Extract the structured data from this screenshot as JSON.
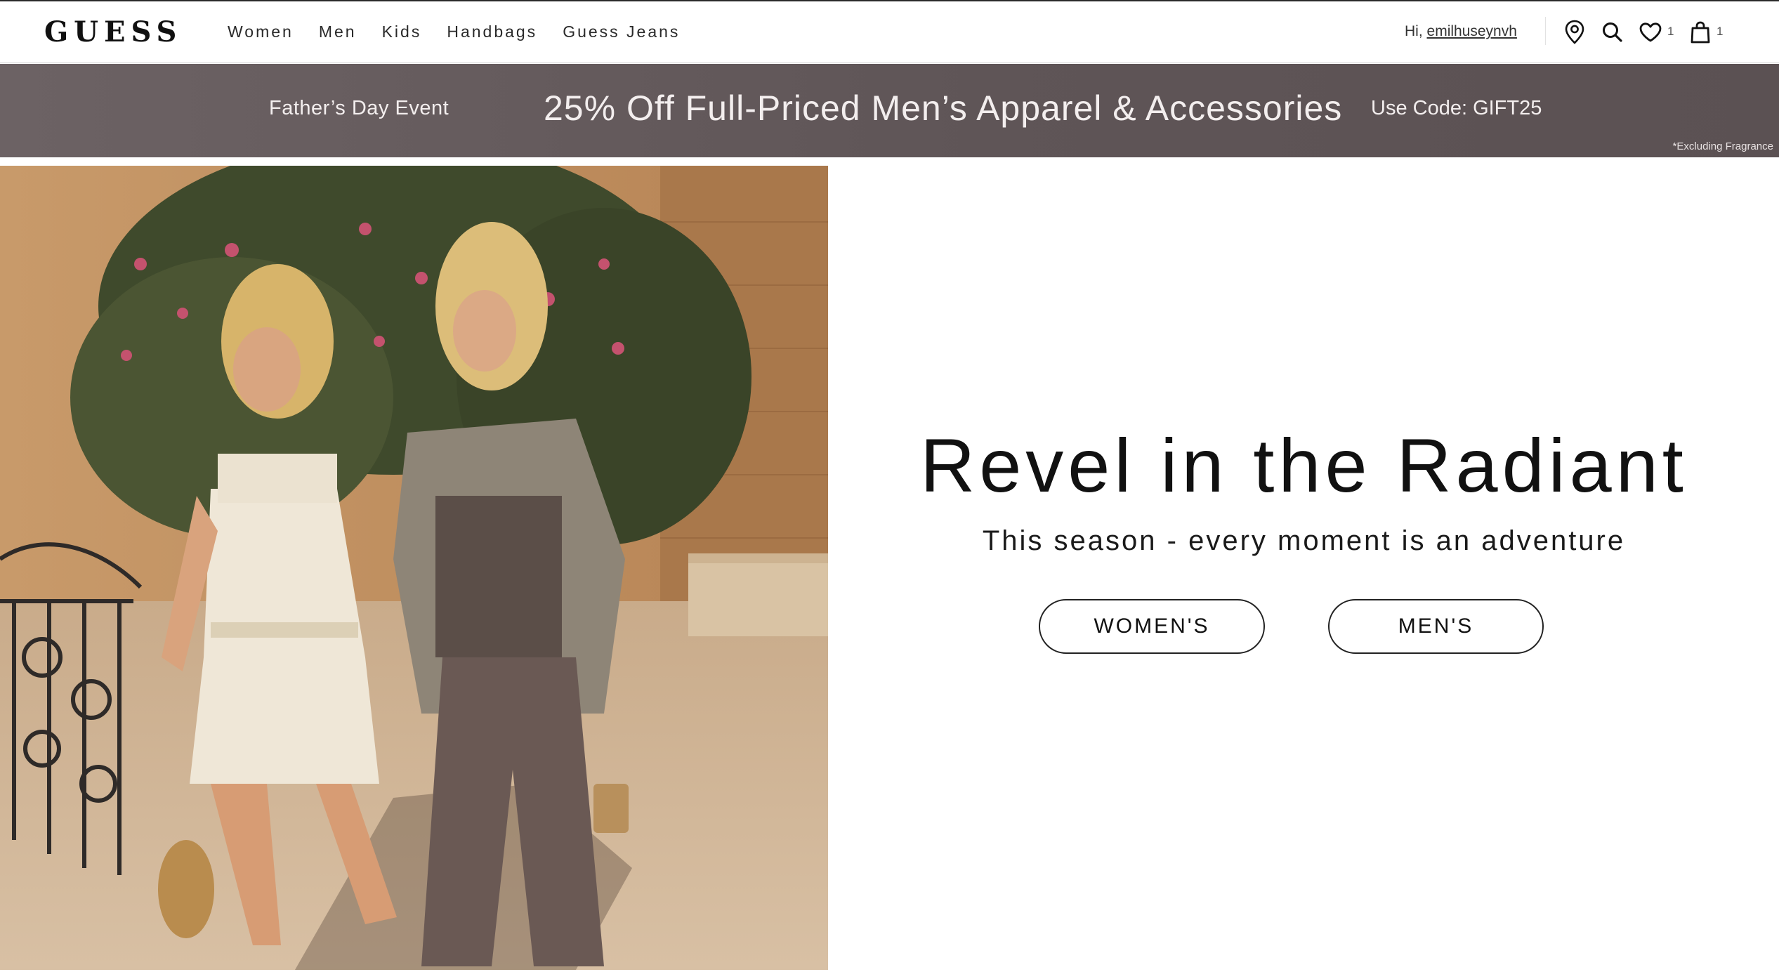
{
  "header": {
    "logo": "GUESS",
    "nav": [
      "Women",
      "Men",
      "Kids",
      "Handbags",
      "Guess Jeans"
    ],
    "greeting_prefix": "Hi,",
    "username": "emilhuseynvh",
    "wishlist_count": "1",
    "bag_count": "1",
    "icons": [
      "location-pin-icon",
      "search-icon",
      "heart-icon",
      "shopping-bag-icon"
    ]
  },
  "promo": {
    "event": "Father’s Day Event",
    "headline": "25% Off Full-Priced Men’s Apparel & Accessories",
    "code": "Use Code: GIFT25",
    "note": "*Excluding Fragrance",
    "background": "#61575a"
  },
  "hero": {
    "title": "Revel in the Radiant",
    "subtitle": "This season - every moment is an adventure",
    "buttons": {
      "womens": "WOMEN'S",
      "mens": "MEN'S"
    }
  }
}
